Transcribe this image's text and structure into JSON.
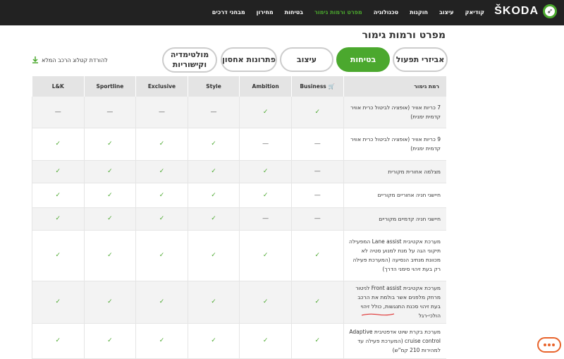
{
  "header": {
    "brand": "ŠKODA",
    "nav": [
      "קודיאק",
      "עיצוב",
      "חוקנות",
      "טכנולוגיה",
      "מפרט ורמות גימור",
      "בטיחות",
      "מחירון",
      "מבחני דרכים"
    ]
  },
  "page_title": "מפרט ורמות גימור",
  "tabs": [
    "אביזרי תפעול",
    "בטיחות",
    "עיצוב",
    "פתרונות אחסון",
    "מולטימדיה וקישוריות"
  ],
  "download_label": "להורדת קטלוג הרכב המלא",
  "table": {
    "headers": [
      "רמת גימור",
      "Business",
      "Ambition",
      "Style",
      "Exclusive",
      "Sportline",
      "L&K"
    ],
    "rows": [
      {
        "feature": "7 כריות אוויר (אופציה לביטול כרית אוויר קדמית ימנית)",
        "values": [
          "check",
          "check",
          "—",
          "—",
          "—",
          "—"
        ]
      },
      {
        "feature": "9 כריות אוויר (אופציה לביטול כרית אוויר קדמית ימנית)",
        "values": [
          "—",
          "—",
          "check",
          "check",
          "check",
          "check"
        ]
      },
      {
        "feature": "מצלמה אחורית מקורית",
        "values": [
          "—",
          "check",
          "check",
          "check",
          "check",
          "check"
        ]
      },
      {
        "feature": "חיישני חניה אחוריים מקוריים",
        "values": [
          "—",
          "check",
          "check",
          "check",
          "check",
          "check"
        ]
      },
      {
        "feature": "חיישני חניה קדמיים מקוריים",
        "values": [
          "—",
          "—",
          "check",
          "check",
          "check",
          "check"
        ]
      },
      {
        "feature": "מערכת אקטיבית Lane assist המפעילה תיקוני הגה על מנת למנוע סטיה לא מכוונת מנתיב הנסיעה (המערכת פעילה רק בעת זיהוי סימני הדרך)",
        "values": [
          "check",
          "check",
          "check",
          "check",
          "check",
          "check"
        ]
      },
      {
        "feature": "מערכת אקטיבית Front assist לניטור מרחק מלפנים אשר בולמת את הרכב בעת זיהוי סכנת התנגשות, כולל זיהוי הולכי-רגל",
        "values": [
          "check",
          "check",
          "check",
          "check",
          "check",
          "check"
        ]
      },
      {
        "feature": "מערכת בקרת שיוט אדפטיבית Adaptive cruise control (המערכת פעילה עד למהירות 210 קמ\"ש)",
        "values": [
          "check",
          "check",
          "check",
          "check",
          "check",
          "check"
        ]
      }
    ]
  },
  "colors": {
    "accent": "#4ba82e",
    "header_bg": "#222222",
    "chat": "#e8632b"
  }
}
